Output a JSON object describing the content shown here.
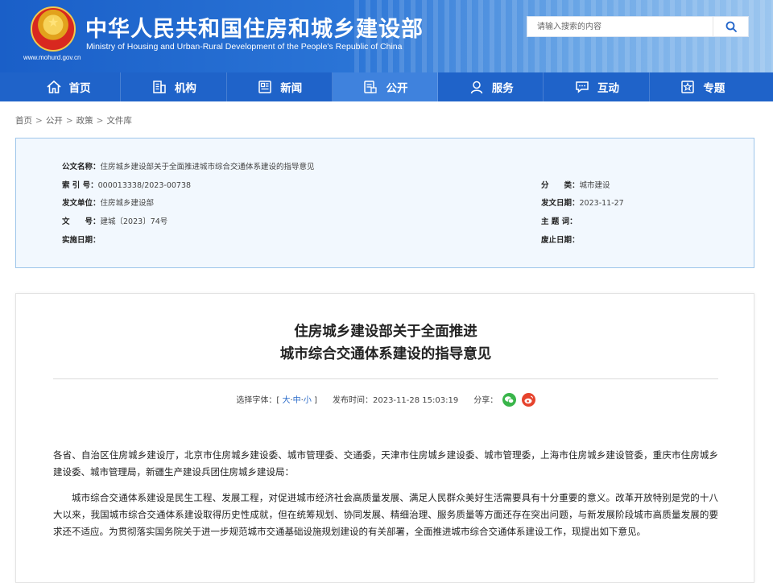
{
  "header": {
    "title": "中华人民共和国住房和城乡建设部",
    "subtitle": "Ministry of Housing and Urban-Rural Development of the People's Republic of China",
    "site_url": "www.mohurd.gov.cn",
    "search_placeholder": "请输入搜索的内容",
    "brand_color": "#1f63c9"
  },
  "nav": {
    "items": [
      {
        "label": "首页",
        "icon": "home-icon"
      },
      {
        "label": "机构",
        "icon": "building-icon"
      },
      {
        "label": "新闻",
        "icon": "news-icon"
      },
      {
        "label": "公开",
        "icon": "public-icon",
        "active": true
      },
      {
        "label": "服务",
        "icon": "service-icon"
      },
      {
        "label": "互动",
        "icon": "chat-icon"
      },
      {
        "label": "专题",
        "icon": "star-icon"
      }
    ]
  },
  "breadcrumb": [
    "首页",
    "公开",
    "政策",
    "文件库"
  ],
  "meta": {
    "doc_name_label": "公文名称：",
    "doc_name": "住房城乡建设部关于全面推进城市综合交通体系建设的指导意见",
    "index_label": "索 引 号：",
    "index": "000013338/2023-00738",
    "category_label": "分　　类：",
    "category": "城市建设",
    "issuer_label": "发文单位：",
    "issuer": "住房城乡建设部",
    "date_label": "发文日期：",
    "date": "2023-11-27",
    "number_label": "文　　号：",
    "number": "建城〔2023〕74号",
    "keywords_label": "主 题 词：",
    "keywords": "",
    "effective_label": "实施日期：",
    "effective": "",
    "repeal_label": "废止日期：",
    "repeal": ""
  },
  "article": {
    "title_line1": "住房城乡建设部关于全面推进",
    "title_line2": "城市综合交通体系建设的指导意见",
    "font_label": "选择字体：",
    "font_open": "[",
    "font_large": "大",
    "font_medium": "中",
    "font_small": "小",
    "font_close": "]",
    "publish_label": "发布时间：",
    "publish_time": "2023-11-28 15:03:19",
    "share_label": "分享：",
    "para1": "各省、自治区住房城乡建设厅，北京市住房城乡建设委、城市管理委、交通委，天津市住房城乡建设委、城市管理委，上海市住房城乡建设管委，重庆市住房城乡建设委、城市管理局，新疆生产建设兵团住房城乡建设局：",
    "para2": "城市综合交通体系建设是民生工程、发展工程，对促进城市经济社会高质量发展、满足人民群众美好生活需要具有十分重要的意义。改革开放特别是党的十八大以来，我国城市综合交通体系建设取得历史性成就，但在统筹规划、协同发展、精细治理、服务质量等方面还存在突出问题，与新发展阶段城市高质量发展的要求还不适应。为贯彻落实国务院关于进一步规范城市交通基础设施规划建设的有关部署，全面推进城市综合交通体系建设工作，现提出如下意见。"
  }
}
